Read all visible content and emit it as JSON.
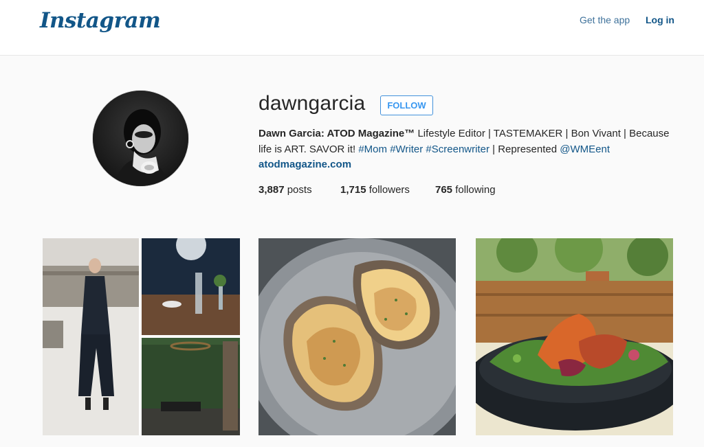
{
  "header": {
    "logo": "Instagram",
    "get_app_label": "Get the app",
    "login_label": "Log in",
    "brand_color": "#125688"
  },
  "profile": {
    "username": "dawngarcia",
    "follow_label": "FOLLOW",
    "bio": {
      "name": "Dawn Garcia: ATOD Magazine™",
      "text1": " Lifestyle Editor | TASTEMAKER | Bon Vivant | Because life is ART. SAVOR it! ",
      "tag1": "#Mom",
      "tag2": "#Writer",
      "tag3": "#Screenwriter",
      "text2": " | Represented ",
      "mention": "@WMEent",
      "website": "atodmagazine.com"
    },
    "stats": {
      "posts_count": "3,887",
      "posts_label": " posts",
      "followers_count": "1,715",
      "followers_label": " followers",
      "following_count": "765",
      "following_label": " following"
    },
    "avatar_icon": "profile-photo"
  },
  "posts": [
    {
      "description_icon": "fashion-collage-photo"
    },
    {
      "description_icon": "oysters-photo"
    },
    {
      "description_icon": "salad-bowl-photo"
    }
  ],
  "colors": {
    "link": "#125688",
    "follow_button": "#3897f0",
    "background": "#fafafa"
  }
}
